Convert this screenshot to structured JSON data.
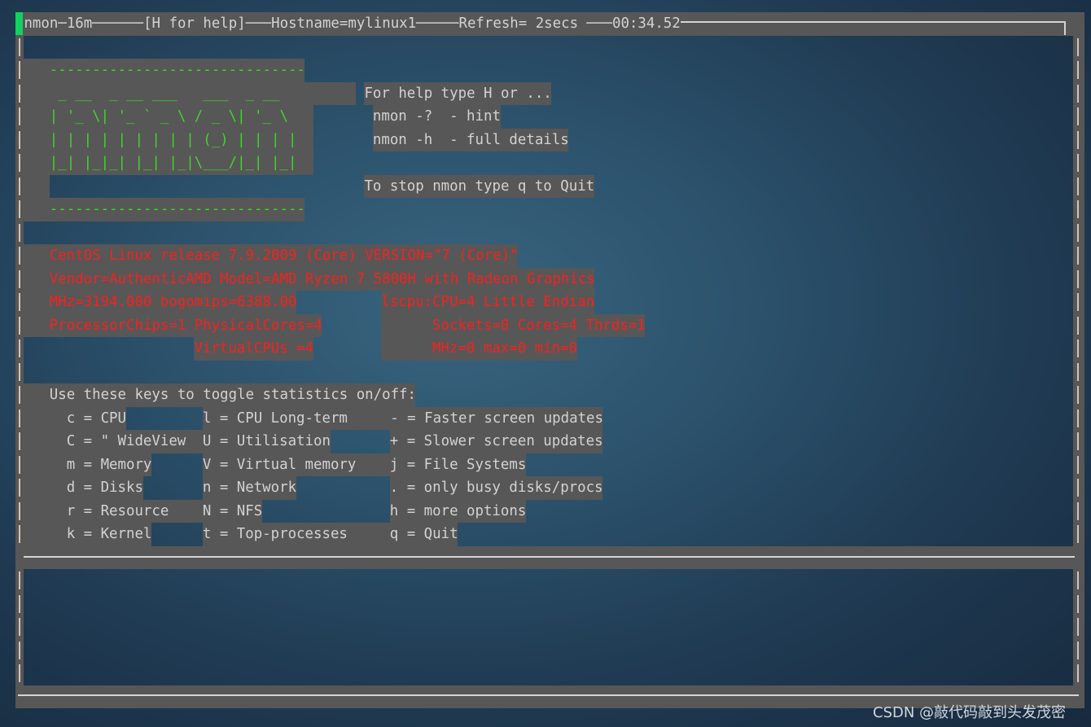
{
  "title_bar": {
    "app": "nmon",
    "version": "16m",
    "help_hint": "[H for help]",
    "hostname": "Hostname=mylinux1",
    "refresh": "Refresh= 2secs ",
    "elapsed": "00:34.52"
  },
  "banner": {
    "dash_top": "------------------------------",
    "art": [
      " _ __  _ __ ___   ___  _ __  ",
      "| '_ \\| '_ ` _ \\ / _ \\| '_ \\ ",
      "| | | | | | | | | (_) | | | |",
      "|_| |_|_| |_| |_|\\___/|_| |_|"
    ],
    "dash_bottom": "------------------------------"
  },
  "help": {
    "line1": "For help type H or ...",
    "hint": "nmon -?  - hint",
    "full": "nmon -h  - full details",
    "stop": "To stop nmon type q to Quit"
  },
  "sysinfo": {
    "release": "CentOS Linux release 7.9.2009 (Core) VERSION=\"7 (Core)\"",
    "vendor": "Vendor=AuthenticAMD Model=AMD Ryzen 7 5800H with Radeon Graphics",
    "mhz": "MHz=3194.000 bogomips=6388.00",
    "lscpu": "lscpu:CPU=4 Little Endian",
    "chips": "ProcessorChips=1 PhysicalCores=4",
    "sockets": "Sockets=0 Cores=4 Thrds=1",
    "vcpus": "VirtualCPUs =4",
    "mhz_range": "MHz=0 max=0 min=0"
  },
  "keys": {
    "heading": "Use these keys to toggle statistics on/off:",
    "rows": [
      [
        "c = CPU",
        "l = CPU Long-term     - = Faster screen updates",
        ""
      ],
      [
        "C = \" WideView",
        "U = Utilisation",
        "+ = Slower screen updates"
      ],
      [
        "m = Memory",
        "V = Virtual memory",
        "j = File Systems"
      ],
      [
        "d = Disks",
        "n = Network",
        ". = only busy disks/procs"
      ],
      [
        "r = Resource",
        "N = NFS",
        "h = more options"
      ],
      [
        "k = Kernel",
        "t = Top-processes",
        "q = Quit"
      ]
    ]
  },
  "colors": {
    "panel": "#575757",
    "text": "#d2d2d2",
    "logo_green": "#3fd62b",
    "info_red": "#f3231f",
    "cursor": "#12d163"
  },
  "watermark": "CSDN @敲代码敲到头发茂密"
}
